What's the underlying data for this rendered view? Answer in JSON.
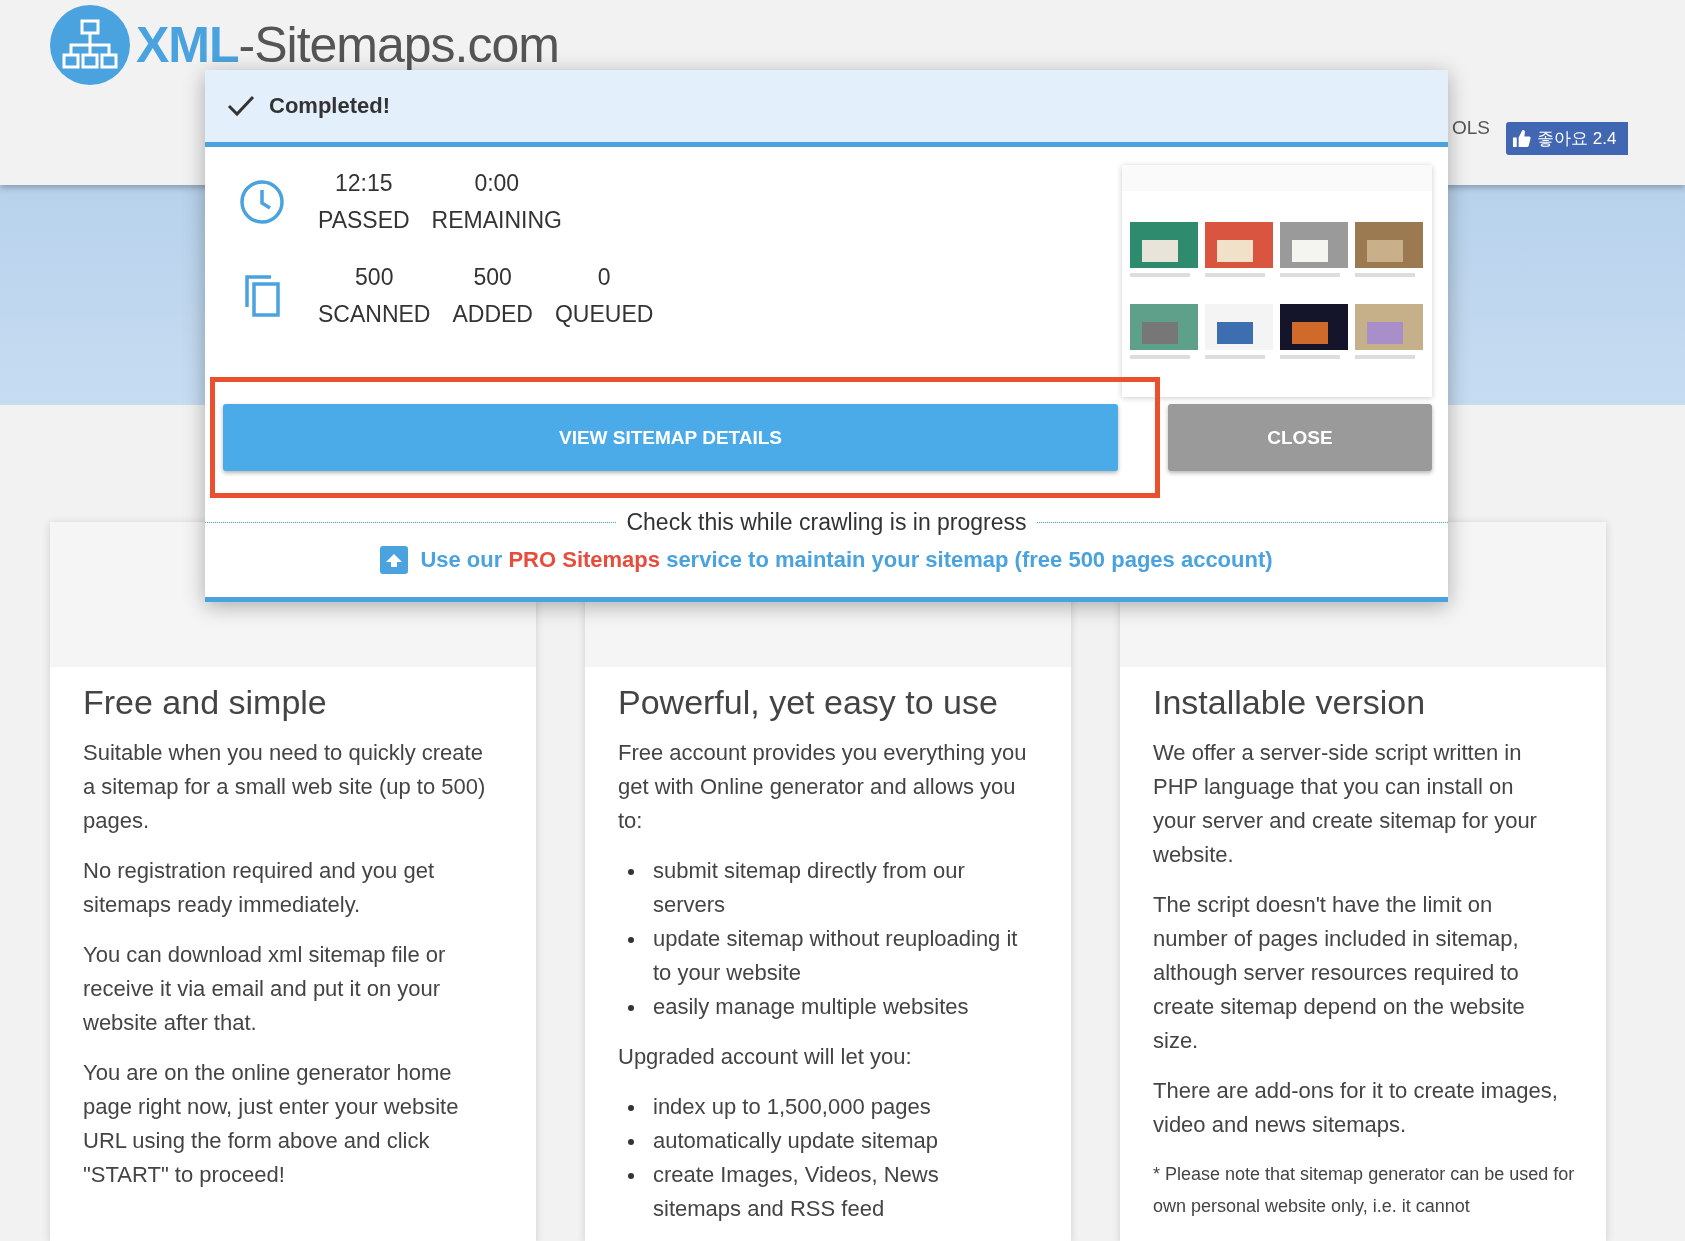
{
  "header": {
    "logo_text": {
      "bold": "XML",
      "rest": "-Sitemaps.com"
    },
    "nav_partial": "OLS",
    "like_button": {
      "label": "좋아요 2.4"
    }
  },
  "dialog": {
    "title": "Completed!",
    "stat_groups": [
      {
        "kind": "time",
        "stats": [
          {
            "value": "12:15",
            "label": "PASSED"
          },
          {
            "value": "0:00",
            "label": "REMAINING"
          }
        ]
      },
      {
        "kind": "pages",
        "stats": [
          {
            "value": "500",
            "label": "SCANNED"
          },
          {
            "value": "500",
            "label": "ADDED"
          },
          {
            "value": "0",
            "label": "QUEUED"
          }
        ]
      }
    ],
    "primary_button": "VIEW SITEMAP DETAILS",
    "close_button": "CLOSE",
    "highlighted": true,
    "divider_text": "Check this while crawling is in progress",
    "pro_link": [
      {
        "kind": "plain",
        "text": "Use our "
      },
      {
        "kind": "accent",
        "text": "PRO Sitemaps"
      },
      {
        "kind": "plain",
        "text": " service to maintain your sitemap (free 500 pages account)"
      }
    ]
  },
  "cards": [
    {
      "heading": "Free and simple",
      "blocks": [
        {
          "kind": "p",
          "text": "Suitable when you need to quickly create a sitemap for a small web site (up to 500) pages."
        },
        {
          "kind": "p",
          "text": "No registration required and you get sitemaps ready immediately."
        },
        {
          "kind": "p",
          "text": "You can download xml sitemap file or receive it via email and put it on your website after that."
        },
        {
          "kind": "p",
          "text": "You are on the online generator home page right now, just enter your website URL using the form above and click \"START\" to proceed!"
        }
      ]
    },
    {
      "heading": "Powerful, yet easy to use",
      "blocks": [
        {
          "kind": "p",
          "text": "Free account provides you everything you get with Online generator and allows you to:"
        },
        {
          "kind": "list",
          "items": [
            "submit sitemap directly from our servers",
            "update sitemap without reuploading it to your website",
            "easily manage multiple websites"
          ]
        },
        {
          "kind": "p",
          "text": "Upgraded account will let you:"
        },
        {
          "kind": "list",
          "items": [
            "index up to 1,500,000 pages",
            "automatically update sitemap",
            "create Images, Videos, News sitemaps and RSS feed"
          ]
        }
      ]
    },
    {
      "heading": "Installable version",
      "blocks": [
        {
          "kind": "p",
          "text": "We offer a server-side script written in PHP language that you can install on your server and create sitemap for your website."
        },
        {
          "kind": "p",
          "text": "The script doesn't have the limit on number of pages included in sitemap, although server resources required to create sitemap depend on the website size."
        },
        {
          "kind": "p",
          "text": "There are add-ons for it to create images, video and news sitemaps."
        },
        {
          "kind": "note",
          "text": "* Please note that sitemap generator can be used for own personal website only, i.e. it cannot"
        }
      ]
    }
  ]
}
